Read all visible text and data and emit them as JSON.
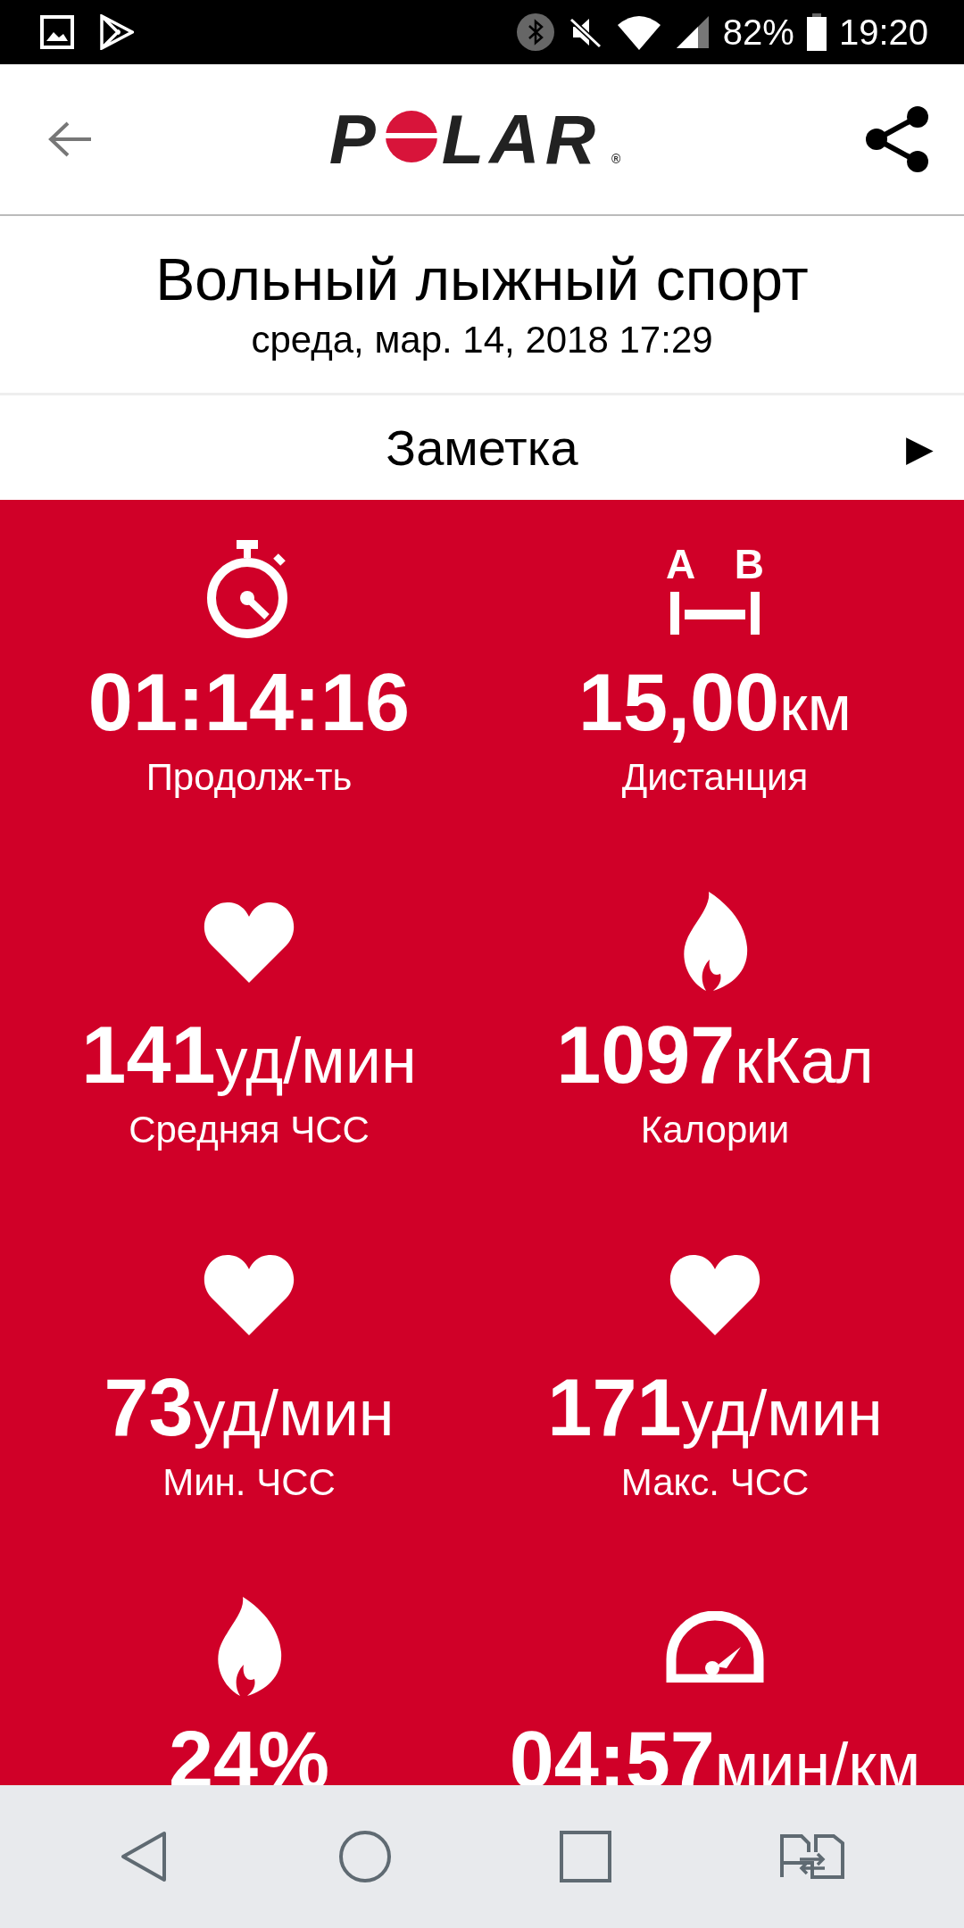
{
  "status_bar": {
    "battery": "82%",
    "time": "19:20"
  },
  "header": {
    "logo": {
      "before": "P",
      "after": "LAR",
      "mark": "®"
    }
  },
  "workout": {
    "title": "Вольный лыжный спорт",
    "date": "среда, мар. 14, 2018 17:29"
  },
  "note": {
    "label": "Заметка",
    "arrow": "▶"
  },
  "stat_rows": [
    {
      "tiles": [
        {
          "kind": "timer",
          "value": "01:14:16",
          "label": "Продолж-ть"
        },
        {
          "kind": "distance",
          "icon_letters": [
            "A",
            "B"
          ],
          "value": "15,00",
          "unit": "км",
          "label": "Дистанция"
        }
      ]
    },
    {
      "tiles": [
        {
          "kind": "heart",
          "value": "141",
          "unit": "уд/мин",
          "label": "Средняя ЧСС"
        },
        {
          "kind": "flame",
          "value": "1097",
          "unit": "кКал",
          "label": "Калории"
        }
      ]
    },
    {
      "tiles": [
        {
          "kind": "heart",
          "value": "73",
          "unit": "уд/мин",
          "label": "Мин. ЧСС"
        },
        {
          "kind": "heart",
          "value": "171",
          "unit": "уд/мин",
          "label": "Макс. ЧСС"
        }
      ]
    },
    {
      "tiles": [
        {
          "kind": "flame",
          "value": "24%"
        },
        {
          "kind": "speed",
          "value": "04:57",
          "unit": "мин/км"
        }
      ]
    }
  ]
}
